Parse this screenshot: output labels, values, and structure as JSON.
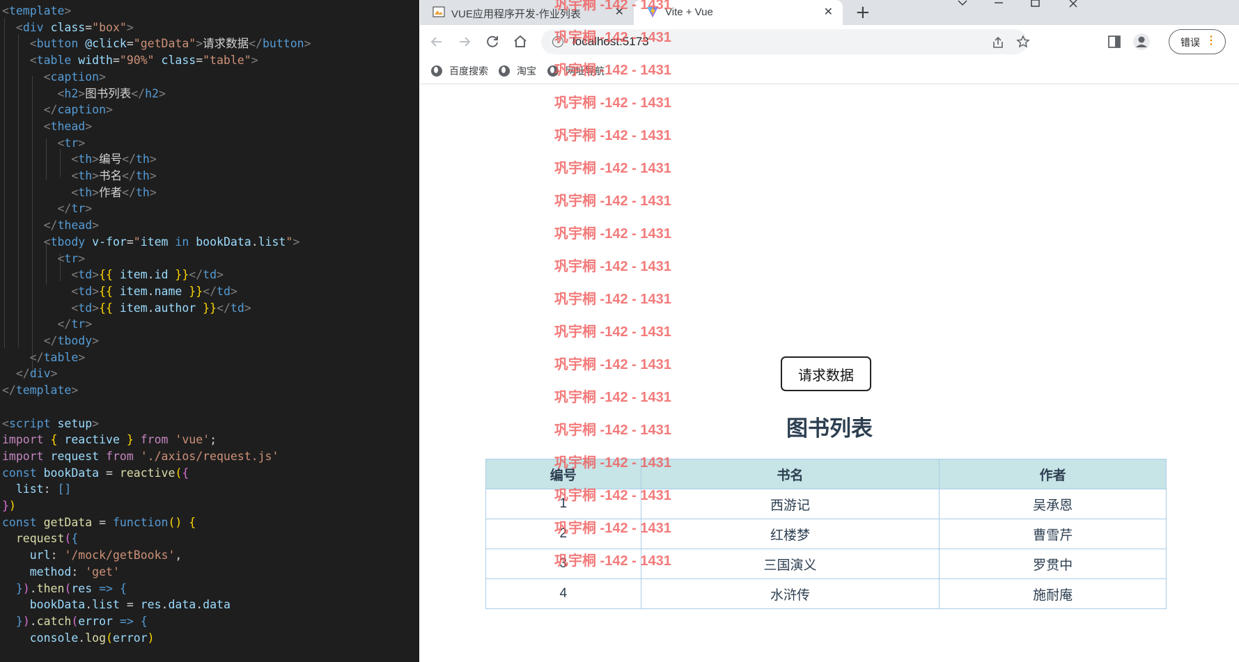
{
  "editor": {
    "lines": [
      [
        [
          "t-punct",
          "<"
        ],
        [
          "t-tag",
          "template"
        ],
        [
          "t-punct",
          ">"
        ]
      ],
      [
        [
          "t-txt",
          "  "
        ],
        [
          "t-punct",
          "<"
        ],
        [
          "t-tag",
          "div"
        ],
        [
          "t-txt",
          " "
        ],
        [
          "t-attr",
          "class"
        ],
        [
          "t-txt",
          "="
        ],
        [
          "t-str",
          "\"box\""
        ],
        [
          "t-punct",
          ">"
        ]
      ],
      [
        [
          "t-txt",
          "    "
        ],
        [
          "t-punct",
          "<"
        ],
        [
          "t-tag",
          "button"
        ],
        [
          "t-txt",
          " "
        ],
        [
          "t-attr",
          "@click"
        ],
        [
          "t-txt",
          "="
        ],
        [
          "t-str",
          "\"getData\""
        ],
        [
          "t-punct",
          ">"
        ],
        [
          "t-txt",
          "请求数据"
        ],
        [
          "t-punct",
          "</"
        ],
        [
          "t-tag",
          "button"
        ],
        [
          "t-punct",
          ">"
        ]
      ],
      [
        [
          "t-txt",
          "    "
        ],
        [
          "t-punct",
          "<"
        ],
        [
          "t-tag",
          "table"
        ],
        [
          "t-txt",
          " "
        ],
        [
          "t-attr",
          "width"
        ],
        [
          "t-txt",
          "="
        ],
        [
          "t-str",
          "\"90%\""
        ],
        [
          "t-txt",
          " "
        ],
        [
          "t-attr",
          "class"
        ],
        [
          "t-txt",
          "="
        ],
        [
          "t-str",
          "\"table\""
        ],
        [
          "t-punct",
          ">"
        ]
      ],
      [
        [
          "t-txt",
          "      "
        ],
        [
          "t-punct",
          "<"
        ],
        [
          "t-tag",
          "caption"
        ],
        [
          "t-punct",
          ">"
        ]
      ],
      [
        [
          "t-txt",
          "        "
        ],
        [
          "t-punct",
          "<"
        ],
        [
          "t-tag",
          "h2"
        ],
        [
          "t-punct",
          ">"
        ],
        [
          "t-txt",
          "图书列表"
        ],
        [
          "t-punct",
          "</"
        ],
        [
          "t-tag",
          "h2"
        ],
        [
          "t-punct",
          ">"
        ]
      ],
      [
        [
          "t-txt",
          "      "
        ],
        [
          "t-punct",
          "</"
        ],
        [
          "t-tag",
          "caption"
        ],
        [
          "t-punct",
          ">"
        ]
      ],
      [
        [
          "t-txt",
          "      "
        ],
        [
          "t-punct",
          "<"
        ],
        [
          "t-tag",
          "thead"
        ],
        [
          "t-punct",
          ">"
        ]
      ],
      [
        [
          "t-txt",
          "        "
        ],
        [
          "t-punct",
          "<"
        ],
        [
          "t-tag",
          "tr"
        ],
        [
          "t-punct",
          ">"
        ]
      ],
      [
        [
          "t-txt",
          "          "
        ],
        [
          "t-punct",
          "<"
        ],
        [
          "t-tag",
          "th"
        ],
        [
          "t-punct",
          ">"
        ],
        [
          "t-txt",
          "编号"
        ],
        [
          "t-punct",
          "</"
        ],
        [
          "t-tag",
          "th"
        ],
        [
          "t-punct",
          ">"
        ]
      ],
      [
        [
          "t-txt",
          "          "
        ],
        [
          "t-punct",
          "<"
        ],
        [
          "t-tag",
          "th"
        ],
        [
          "t-punct",
          ">"
        ],
        [
          "t-txt",
          "书名"
        ],
        [
          "t-punct",
          "</"
        ],
        [
          "t-tag",
          "th"
        ],
        [
          "t-punct",
          ">"
        ]
      ],
      [
        [
          "t-txt",
          "          "
        ],
        [
          "t-punct",
          "<"
        ],
        [
          "t-tag",
          "th"
        ],
        [
          "t-punct",
          ">"
        ],
        [
          "t-txt",
          "作者"
        ],
        [
          "t-punct",
          "</"
        ],
        [
          "t-tag",
          "th"
        ],
        [
          "t-punct",
          ">"
        ]
      ],
      [
        [
          "t-txt",
          "        "
        ],
        [
          "t-punct",
          "</"
        ],
        [
          "t-tag",
          "tr"
        ],
        [
          "t-punct",
          ">"
        ]
      ],
      [
        [
          "t-txt",
          "      "
        ],
        [
          "t-punct",
          "</"
        ],
        [
          "t-tag",
          "thead"
        ],
        [
          "t-punct",
          ">"
        ]
      ],
      [
        [
          "t-txt",
          "      "
        ],
        [
          "t-punct",
          "<"
        ],
        [
          "t-tag",
          "tbody"
        ],
        [
          "t-txt",
          " "
        ],
        [
          "t-attr",
          "v-for"
        ],
        [
          "t-txt",
          "="
        ],
        [
          "t-str",
          "\""
        ],
        [
          "t-var",
          "item"
        ],
        [
          "t-txt",
          " "
        ],
        [
          "t-kw2",
          "in"
        ],
        [
          "t-txt",
          " "
        ],
        [
          "t-var",
          "bookData"
        ],
        [
          "t-txt",
          "."
        ],
        [
          "t-var",
          "list"
        ],
        [
          "t-str",
          "\""
        ],
        [
          "t-punct",
          ">"
        ]
      ],
      [
        [
          "t-txt",
          "        "
        ],
        [
          "t-punct",
          "<"
        ],
        [
          "t-tag",
          "tr"
        ],
        [
          "t-punct",
          ">"
        ]
      ],
      [
        [
          "t-txt",
          "          "
        ],
        [
          "t-punct",
          "<"
        ],
        [
          "t-tag",
          "td"
        ],
        [
          "t-punct",
          ">"
        ],
        [
          "t-br",
          "{{"
        ],
        [
          "t-txt",
          " "
        ],
        [
          "t-var",
          "item"
        ],
        [
          "t-txt",
          "."
        ],
        [
          "t-var",
          "id"
        ],
        [
          "t-txt",
          " "
        ],
        [
          "t-br",
          "}}"
        ],
        [
          "t-punct",
          "</"
        ],
        [
          "t-tag",
          "td"
        ],
        [
          "t-punct",
          ">"
        ]
      ],
      [
        [
          "t-txt",
          "          "
        ],
        [
          "t-punct",
          "<"
        ],
        [
          "t-tag",
          "td"
        ],
        [
          "t-punct",
          ">"
        ],
        [
          "t-br",
          "{{"
        ],
        [
          "t-txt",
          " "
        ],
        [
          "t-var",
          "item"
        ],
        [
          "t-txt",
          "."
        ],
        [
          "t-var",
          "name"
        ],
        [
          "t-txt",
          " "
        ],
        [
          "t-br",
          "}}"
        ],
        [
          "t-punct",
          "</"
        ],
        [
          "t-tag",
          "td"
        ],
        [
          "t-punct",
          ">"
        ]
      ],
      [
        [
          "t-txt",
          "          "
        ],
        [
          "t-punct",
          "<"
        ],
        [
          "t-tag",
          "td"
        ],
        [
          "t-punct",
          ">"
        ],
        [
          "t-br",
          "{{"
        ],
        [
          "t-txt",
          " "
        ],
        [
          "t-var",
          "item"
        ],
        [
          "t-txt",
          "."
        ],
        [
          "t-var",
          "author"
        ],
        [
          "t-txt",
          " "
        ],
        [
          "t-br",
          "}}"
        ],
        [
          "t-punct",
          "</"
        ],
        [
          "t-tag",
          "td"
        ],
        [
          "t-punct",
          ">"
        ]
      ],
      [
        [
          "t-txt",
          "        "
        ],
        [
          "t-punct",
          "</"
        ],
        [
          "t-tag",
          "tr"
        ],
        [
          "t-punct",
          ">"
        ]
      ],
      [
        [
          "t-txt",
          "      "
        ],
        [
          "t-punct",
          "</"
        ],
        [
          "t-tag",
          "tbody"
        ],
        [
          "t-punct",
          ">"
        ]
      ],
      [
        [
          "t-txt",
          "    "
        ],
        [
          "t-punct",
          "</"
        ],
        [
          "t-tag",
          "table"
        ],
        [
          "t-punct",
          ">"
        ]
      ],
      [
        [
          "t-txt",
          "  "
        ],
        [
          "t-punct",
          "</"
        ],
        [
          "t-tag",
          "div"
        ],
        [
          "t-punct",
          ">"
        ]
      ],
      [
        [
          "t-punct",
          "</"
        ],
        [
          "t-tag",
          "template"
        ],
        [
          "t-punct",
          ">"
        ]
      ],
      [],
      [
        [
          "t-punct",
          "<"
        ],
        [
          "t-tag",
          "script"
        ],
        [
          "t-txt",
          " "
        ],
        [
          "t-attr",
          "setup"
        ],
        [
          "t-punct",
          ">"
        ]
      ],
      [
        [
          "t-kw",
          "import"
        ],
        [
          "t-txt",
          " "
        ],
        [
          "t-br",
          "{"
        ],
        [
          "t-txt",
          " "
        ],
        [
          "t-var",
          "reactive"
        ],
        [
          "t-txt",
          " "
        ],
        [
          "t-br",
          "}"
        ],
        [
          "t-txt",
          " "
        ],
        [
          "t-kw",
          "from"
        ],
        [
          "t-txt",
          " "
        ],
        [
          "t-str",
          "'vue'"
        ],
        [
          "t-txt",
          ";"
        ]
      ],
      [
        [
          "t-kw",
          "import"
        ],
        [
          "t-txt",
          " "
        ],
        [
          "t-var",
          "request"
        ],
        [
          "t-txt",
          " "
        ],
        [
          "t-kw",
          "from"
        ],
        [
          "t-txt",
          " "
        ],
        [
          "t-str",
          "'./axios/request.js'"
        ]
      ],
      [
        [
          "t-kw2",
          "const"
        ],
        [
          "t-txt",
          " "
        ],
        [
          "t-var",
          "bookData"
        ],
        [
          "t-txt",
          " = "
        ],
        [
          "t-fn",
          "reactive"
        ],
        [
          "t-br",
          "("
        ],
        [
          "t-br2",
          "{"
        ]
      ],
      [
        [
          "t-txt",
          "  "
        ],
        [
          "t-var",
          "list"
        ],
        [
          "t-txt",
          ": "
        ],
        [
          "t-kw2",
          "[]"
        ]
      ],
      [
        [
          "t-br2",
          "}"
        ],
        [
          "t-br",
          ")"
        ]
      ],
      [
        [
          "t-kw2",
          "const"
        ],
        [
          "t-txt",
          " "
        ],
        [
          "t-fn",
          "getData"
        ],
        [
          "t-txt",
          " = "
        ],
        [
          "t-kw2",
          "function"
        ],
        [
          "t-br",
          "()"
        ],
        [
          "t-txt",
          " "
        ],
        [
          "t-br",
          "{"
        ]
      ],
      [
        [
          "t-txt",
          "  "
        ],
        [
          "t-fn",
          "request"
        ],
        [
          "t-br2",
          "("
        ],
        [
          "t-kw2",
          "{"
        ]
      ],
      [
        [
          "t-txt",
          "    "
        ],
        [
          "t-var",
          "url"
        ],
        [
          "t-txt",
          ": "
        ],
        [
          "t-str",
          "'/mock/getBooks'"
        ],
        [
          "t-txt",
          ","
        ]
      ],
      [
        [
          "t-txt",
          "    "
        ],
        [
          "t-var",
          "method"
        ],
        [
          "t-txt",
          ": "
        ],
        [
          "t-str",
          "'get'"
        ]
      ],
      [
        [
          "t-txt",
          "  "
        ],
        [
          "t-kw2",
          "}"
        ],
        [
          "t-br2",
          ")"
        ],
        [
          "t-txt",
          "."
        ],
        [
          "t-fn",
          "then"
        ],
        [
          "t-br2",
          "("
        ],
        [
          "t-var",
          "res"
        ],
        [
          "t-txt",
          " "
        ],
        [
          "t-kw2",
          "=>"
        ],
        [
          "t-txt",
          " "
        ],
        [
          "t-kw2",
          "{"
        ]
      ],
      [
        [
          "t-txt",
          "    "
        ],
        [
          "t-var",
          "bookData"
        ],
        [
          "t-txt",
          "."
        ],
        [
          "t-var",
          "list"
        ],
        [
          "t-txt",
          " = "
        ],
        [
          "t-var",
          "res"
        ],
        [
          "t-txt",
          "."
        ],
        [
          "t-var",
          "data"
        ],
        [
          "t-txt",
          "."
        ],
        [
          "t-var",
          "data"
        ]
      ],
      [
        [
          "t-txt",
          "  "
        ],
        [
          "t-kw2",
          "}"
        ],
        [
          "t-br2",
          ")"
        ],
        [
          "t-txt",
          "."
        ],
        [
          "t-fn",
          "catch"
        ],
        [
          "t-br2",
          "("
        ],
        [
          "t-var",
          "error"
        ],
        [
          "t-txt",
          " "
        ],
        [
          "t-kw2",
          "=>"
        ],
        [
          "t-txt",
          " "
        ],
        [
          "t-kw2",
          "{"
        ]
      ],
      [
        [
          "t-txt",
          "    "
        ],
        [
          "t-var",
          "console"
        ],
        [
          "t-txt",
          "."
        ],
        [
          "t-fn",
          "log"
        ],
        [
          "t-br",
          "("
        ],
        [
          "t-var",
          "error"
        ],
        [
          "t-br",
          ")"
        ]
      ]
    ]
  },
  "browser": {
    "tabs": [
      {
        "title": "VUE应用程序开发-作业列表",
        "close": "✕"
      },
      {
        "title": "Vite + Vue",
        "close": "✕"
      }
    ],
    "new_tab": "+",
    "url": "localhost:5173",
    "error_button": "错误",
    "bookmarks": [
      "百度搜索",
      "淘宝",
      "网址导航"
    ]
  },
  "page": {
    "button_label": "请求数据",
    "table_title": "图书列表",
    "table_headers": [
      "编号",
      "书名",
      "作者"
    ],
    "table_rows": [
      [
        "1",
        "西游记",
        "吴承恩"
      ],
      [
        "2",
        "红楼梦",
        "曹雪芹"
      ],
      [
        "3",
        "三国演义",
        "罗贯中"
      ],
      [
        "4",
        "水浒传",
        "施耐庵"
      ]
    ]
  },
  "watermark": "巩宇桐 -142 - 1431",
  "colors": {
    "watermark": "#f05a5a",
    "table_header_bg": "#c7e4e6",
    "editor_bg": "#1e1e1e"
  }
}
